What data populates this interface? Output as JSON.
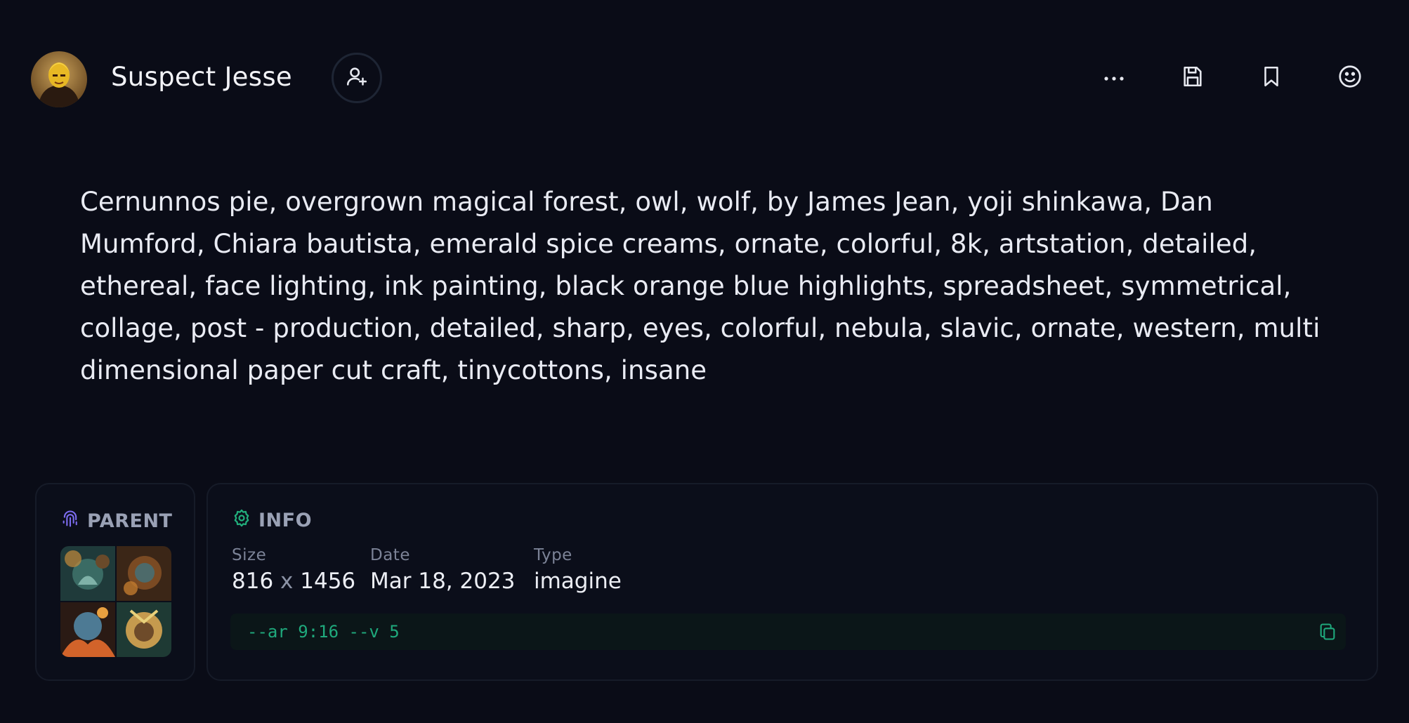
{
  "header": {
    "username": "Suspect Jesse",
    "follow_icon": "user-plus-icon",
    "actions": [
      {
        "icon": "more-horizontal-icon"
      },
      {
        "icon": "save-floppy-icon"
      },
      {
        "icon": "bookmark-icon"
      },
      {
        "icon": "smile-icon"
      }
    ]
  },
  "prompt": "Cernunnos pie, overgrown magical forest, owl, wolf, by James Jean, yoji shinkawa, Dan Mumford, Chiara bautista, emerald spice creams, ornate, colorful, 8k, artstation, detailed, ethereal, face lighting, ink painting, black orange blue highlights, spreadsheet, symmetrical, collage, post - production, detailed, sharp, eyes, colorful, nebula, slavic, ornate, western, multi dimensional paper cut craft, tinycottons, insane",
  "parent": {
    "title": "PARENT",
    "icon": "fingerprint-icon",
    "accent": "#7c6cf0"
  },
  "info": {
    "title": "INFO",
    "icon": "gear-icon",
    "accent": "#22b07d",
    "size_label": "Size",
    "size_width": "816",
    "size_x": "x",
    "size_height": "1456",
    "date_label": "Date",
    "date_value": "Mar 18, 2023",
    "type_label": "Type",
    "type_value": "imagine",
    "params": "--ar 9:16 --v 5",
    "copy_icon": "copy-icon"
  }
}
